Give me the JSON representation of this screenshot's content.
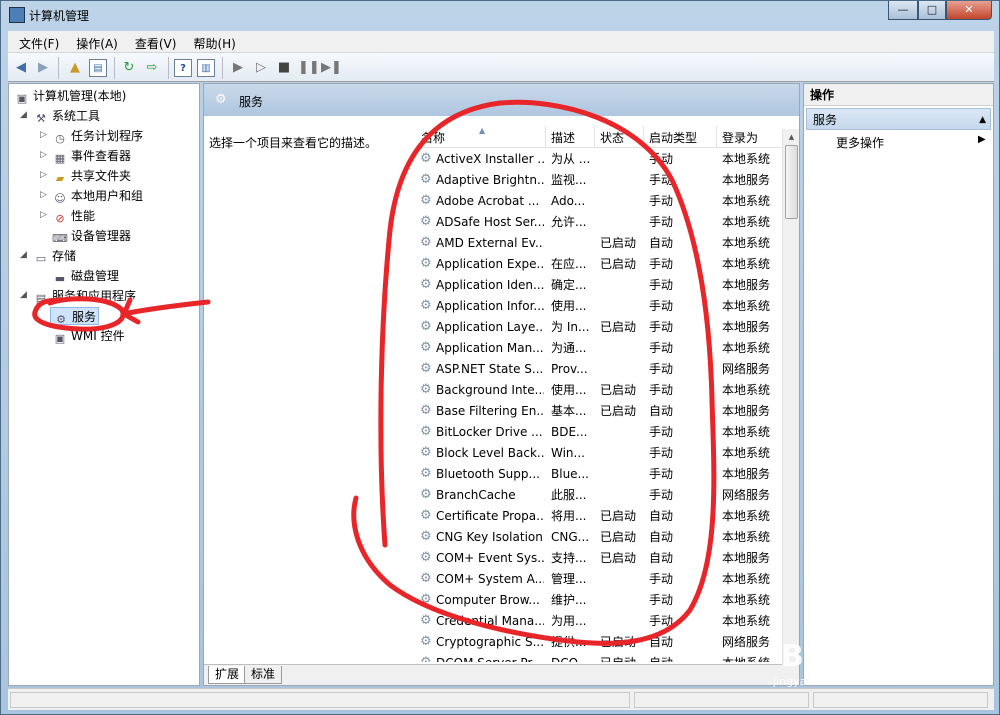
{
  "window": {
    "title": "计算机管理",
    "min": "—",
    "max": "□",
    "close": "✕"
  },
  "menu": [
    "文件(F)",
    "操作(A)",
    "查看(V)",
    "帮助(H)"
  ],
  "tree": {
    "root": "计算机管理(本地)",
    "system_tools": "系统工具",
    "task_scheduler": "任务计划程序",
    "event_viewer": "事件查看器",
    "shared_folders": "共享文件夹",
    "local_users": "本地用户和组",
    "performance": "性能",
    "device_manager": "设备管理器",
    "storage": "存储",
    "disk_management": "磁盘管理",
    "services_apps": "服务和应用程序",
    "services": "服务",
    "wmi": "WMI 控件"
  },
  "center": {
    "header_title": "服务",
    "description": "选择一个项目来查看它的描述。",
    "columns": [
      "名称",
      "描述",
      "状态",
      "启动类型",
      "登录为"
    ],
    "rows": [
      {
        "name": "ActiveX Installer ...",
        "desc": "为从 ...",
        "status": "",
        "startup": "手动",
        "logon": "本地系统"
      },
      {
        "name": "Adaptive Brightn...",
        "desc": "监视...",
        "status": "",
        "startup": "手动",
        "logon": "本地服务"
      },
      {
        "name": "Adobe Acrobat ...",
        "desc": "Ado...",
        "status": "",
        "startup": "手动",
        "logon": "本地系统"
      },
      {
        "name": "ADSafe Host Ser...",
        "desc": "允许...",
        "status": "",
        "startup": "手动",
        "logon": "本地系统"
      },
      {
        "name": "AMD External Ev...",
        "desc": "",
        "status": "已启动",
        "startup": "自动",
        "logon": "本地系统"
      },
      {
        "name": "Application Expe...",
        "desc": "在应...",
        "status": "已启动",
        "startup": "手动",
        "logon": "本地系统"
      },
      {
        "name": "Application Iden...",
        "desc": "确定...",
        "status": "",
        "startup": "手动",
        "logon": "本地服务"
      },
      {
        "name": "Application Infor...",
        "desc": "使用...",
        "status": "",
        "startup": "手动",
        "logon": "本地系统"
      },
      {
        "name": "Application Laye...",
        "desc": "为 In...",
        "status": "已启动",
        "startup": "手动",
        "logon": "本地服务"
      },
      {
        "name": "Application Man...",
        "desc": "为通...",
        "status": "",
        "startup": "手动",
        "logon": "本地系统"
      },
      {
        "name": "ASP.NET State S...",
        "desc": "Prov...",
        "status": "",
        "startup": "手动",
        "logon": "网络服务"
      },
      {
        "name": "Background Inte...",
        "desc": "使用...",
        "status": "已启动",
        "startup": "手动",
        "logon": "本地系统"
      },
      {
        "name": "Base Filtering En...",
        "desc": "基本...",
        "status": "已启动",
        "startup": "自动",
        "logon": "本地服务"
      },
      {
        "name": "BitLocker Drive ...",
        "desc": "BDE...",
        "status": "",
        "startup": "手动",
        "logon": "本地系统"
      },
      {
        "name": "Block Level Back...",
        "desc": "Win...",
        "status": "",
        "startup": "手动",
        "logon": "本地系统"
      },
      {
        "name": "Bluetooth Supp...",
        "desc": "Blue...",
        "status": "",
        "startup": "手动",
        "logon": "本地服务"
      },
      {
        "name": "BranchCache",
        "desc": "此服...",
        "status": "",
        "startup": "手动",
        "logon": "网络服务"
      },
      {
        "name": "Certificate Propa...",
        "desc": "将用...",
        "status": "已启动",
        "startup": "自动",
        "logon": "本地系统"
      },
      {
        "name": "CNG Key Isolation",
        "desc": "CNG...",
        "status": "已启动",
        "startup": "自动",
        "logon": "本地系统"
      },
      {
        "name": "COM+ Event Sys...",
        "desc": "支持...",
        "status": "已启动",
        "startup": "自动",
        "logon": "本地服务"
      },
      {
        "name": "COM+ System A...",
        "desc": "管理...",
        "status": "",
        "startup": "手动",
        "logon": "本地系统"
      },
      {
        "name": "Computer Brow...",
        "desc": "维护...",
        "status": "",
        "startup": "手动",
        "logon": "本地系统"
      },
      {
        "name": "Credential Mana...",
        "desc": "为用...",
        "status": "",
        "startup": "手动",
        "logon": "本地系统"
      },
      {
        "name": "Cryptographic S...",
        "desc": "提供...",
        "status": "已启动",
        "startup": "自动",
        "logon": "网络服务"
      },
      {
        "name": "DCOM Server Pr...",
        "desc": "DCO...",
        "status": "已启动",
        "startup": "自动",
        "logon": "本地系统"
      }
    ],
    "tabs": [
      "扩展",
      "标准"
    ]
  },
  "actions": {
    "header": "操作",
    "section": "服务",
    "more": "更多操作"
  },
  "watermark": {
    "brand": "Bai 经验",
    "url": "jingyan.baidu.com"
  },
  "colors": {
    "annotation_ink": "#e8262a",
    "title_bar": "#bcd3e8",
    "selection": "#cfe3fb"
  }
}
